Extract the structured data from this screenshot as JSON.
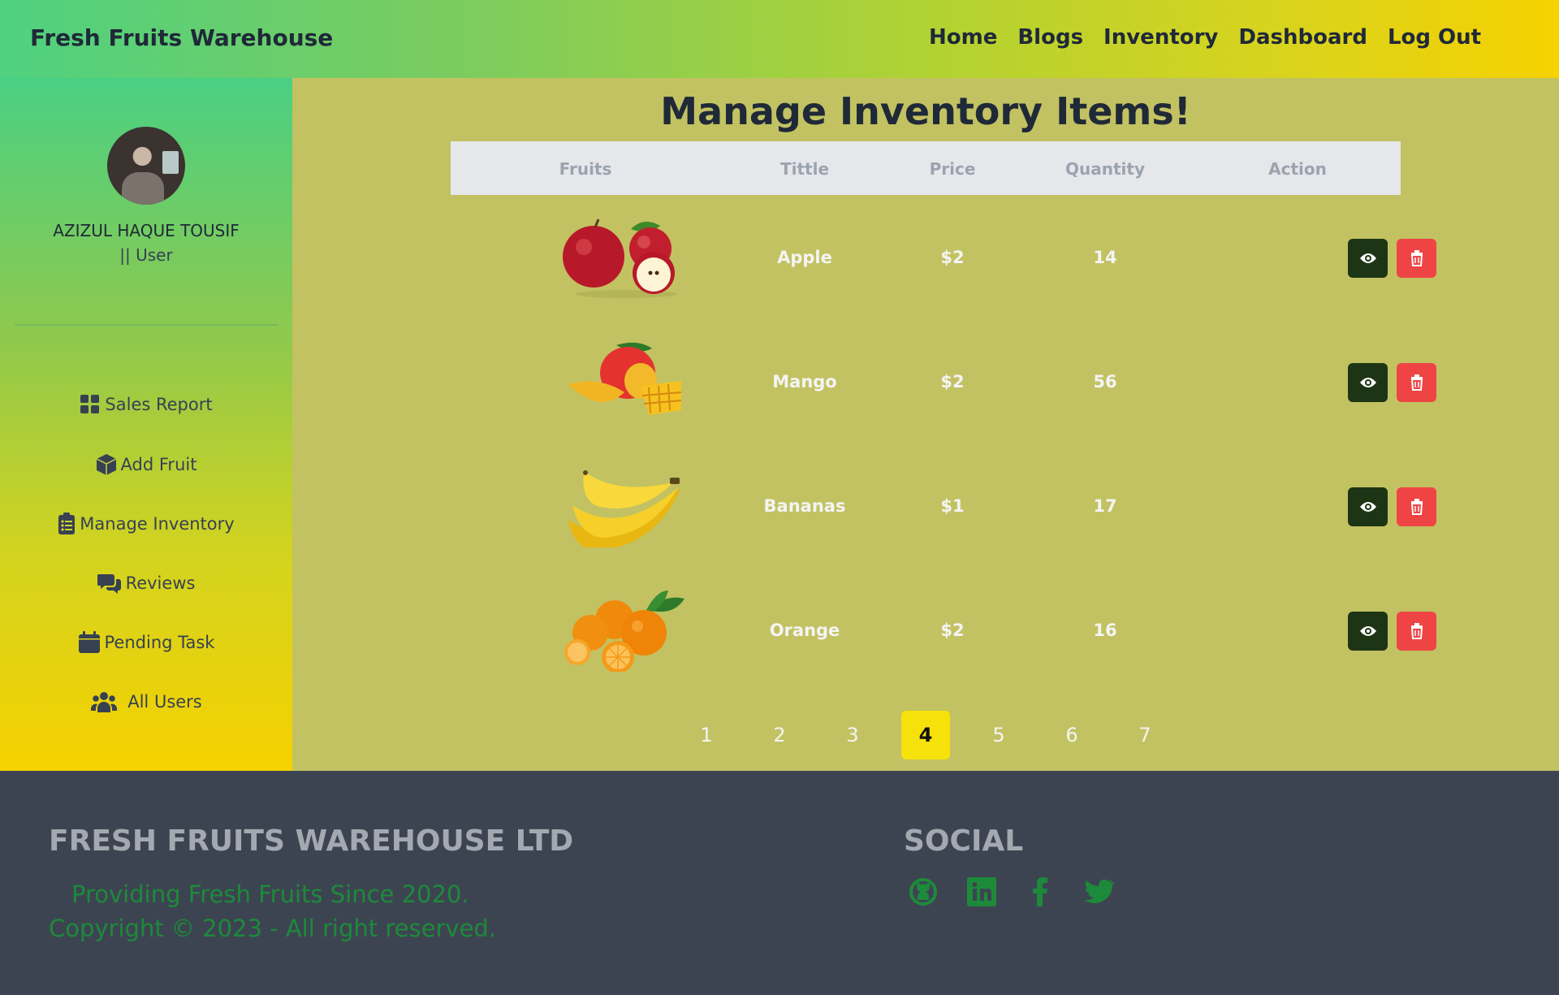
{
  "header": {
    "brand": "Fresh Fruits Warehouse",
    "nav": [
      "Home",
      "Blogs",
      "Inventory",
      "Dashboard",
      "Log Out"
    ]
  },
  "sidebar": {
    "user_name": "AZIZUL HAQUE TOUSIF",
    "user_role": "|| User",
    "items": [
      {
        "label": "Sales Report",
        "icon": "grid-icon"
      },
      {
        "label": "Add Fruit",
        "icon": "box-icon"
      },
      {
        "label": "Manage Inventory",
        "icon": "clipboard-list-icon"
      },
      {
        "label": "Reviews",
        "icon": "chat-icon"
      },
      {
        "label": "Pending Task",
        "icon": "calendar-icon"
      },
      {
        "label": "All Users",
        "icon": "users-icon"
      }
    ]
  },
  "main": {
    "title": "Manage Inventory Items!",
    "columns": [
      "Fruits",
      "Tittle",
      "Price",
      "Quantity",
      "Action"
    ],
    "rows": [
      {
        "fruit": "apple",
        "title": "Apple",
        "price": "$2",
        "quantity": "14"
      },
      {
        "fruit": "mango",
        "title": "Mango",
        "price": "$2",
        "quantity": "56"
      },
      {
        "fruit": "banana",
        "title": "Bananas",
        "price": "$1",
        "quantity": "17"
      },
      {
        "fruit": "orange",
        "title": "Orange",
        "price": "$2",
        "quantity": "16"
      }
    ],
    "pages": [
      "1",
      "2",
      "3",
      "4",
      "5",
      "6",
      "7"
    ],
    "current_page": "4"
  },
  "footer": {
    "company": "FRESH FRUITS WAREHOUSE LTD",
    "tagline": "Providing Fresh Fruits Since 2020.",
    "copyright": "Copyright © 2023 - All right reserved.",
    "social_title": "SOCIAL",
    "social_icons": [
      "github-icon",
      "linkedin-icon",
      "facebook-icon",
      "twitter-icon"
    ]
  },
  "colors": {
    "accent_green": "#1c8a3a",
    "view_button": "#1d3515",
    "delete_button": "#ef4444",
    "active_page": "#f7e10b"
  }
}
